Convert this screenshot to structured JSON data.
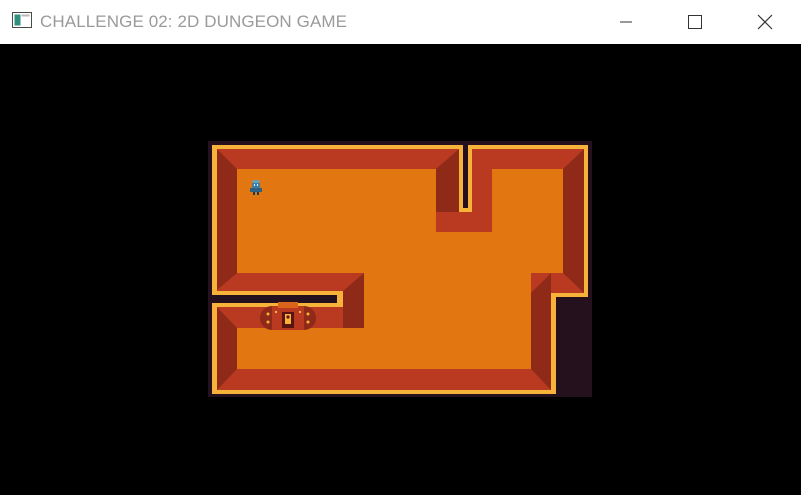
{
  "window": {
    "title": "CHALLENGE 02: 2D DUNGEON GAME",
    "icons": {
      "app": "game-window-icon",
      "minimize": "minimize-icon",
      "maximize": "maximize-icon",
      "close": "close-icon"
    }
  },
  "game": {
    "sprites": {
      "player": "knight-sprite",
      "door": "dungeon-door-sprite"
    },
    "colors": {
      "background": "#000000",
      "void": "#24111d",
      "floor": "#e27712",
      "wall_top": "#b93a21",
      "wall_side": "#8f2a18",
      "wall_rim": "#f7b23a"
    }
  }
}
